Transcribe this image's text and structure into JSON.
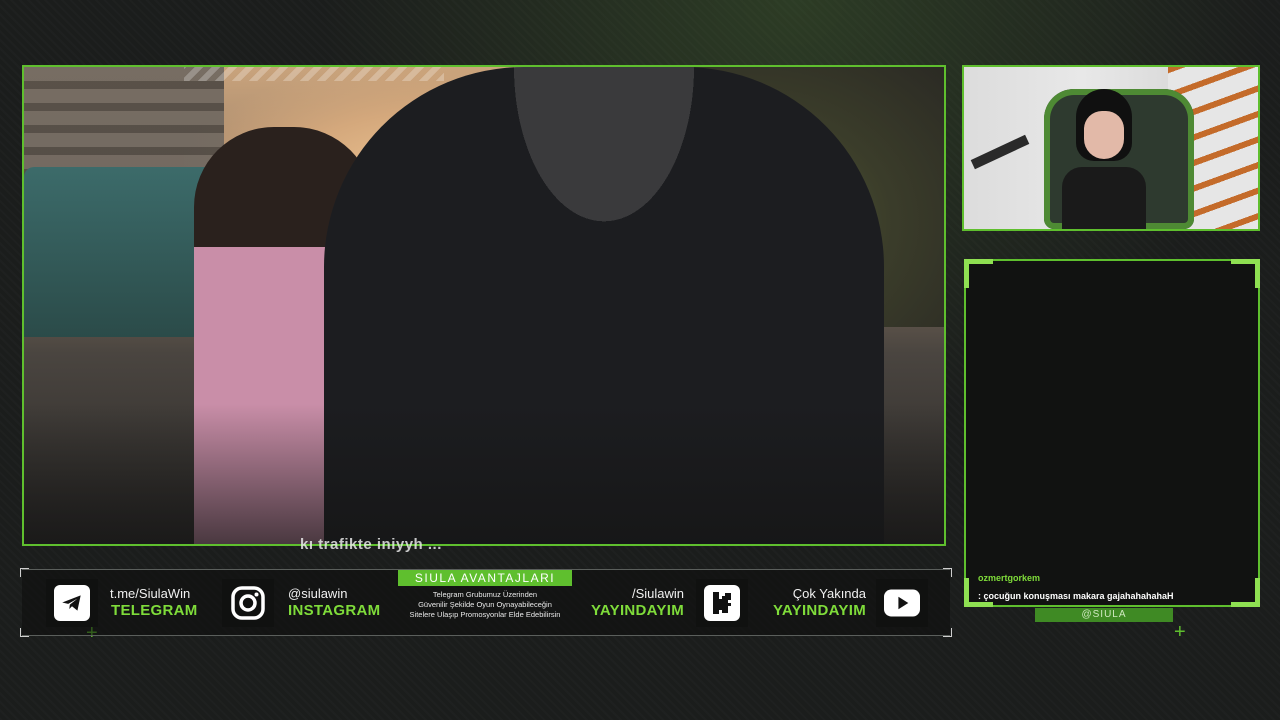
{
  "stream": {
    "subtitle": "kı trafikte iniyyh ... ",
    "handle": "@SIULA"
  },
  "chat": {
    "messages": [
      {
        "user": "ozmertgorkem",
        "text": ": çocuğun konuşması makara gajahahahahaH"
      }
    ]
  },
  "bar": {
    "telegram": {
      "line1": "t.me/SiulaWin",
      "line2": "TELEGRAM",
      "icon": "telegram-icon"
    },
    "instagram": {
      "line1": "@siulawin",
      "line2": "INSTAGRAM",
      "icon": "instagram-icon"
    },
    "promo": {
      "title": "SIULA AVANTAJLARI",
      "lines": [
        "Telegram Grubumuz Üzerinden",
        "Güvenilir Şekilde Oyun Oynayabileceğin",
        "Sitelere Ulaşıp Promosyonlar Elde Edebilirsin"
      ]
    },
    "kick": {
      "line1": "/Siulawin",
      "line2": "YAYINDAYIM",
      "icon": "kick-icon"
    },
    "youtube": {
      "line1": "Çok Yakında",
      "line2": "YAYINDAYIM",
      "icon": "youtube-icon"
    }
  },
  "colors": {
    "accent": "#5fbf2e",
    "accent_light": "#7fdc3a",
    "background": "#1b1d1c"
  }
}
